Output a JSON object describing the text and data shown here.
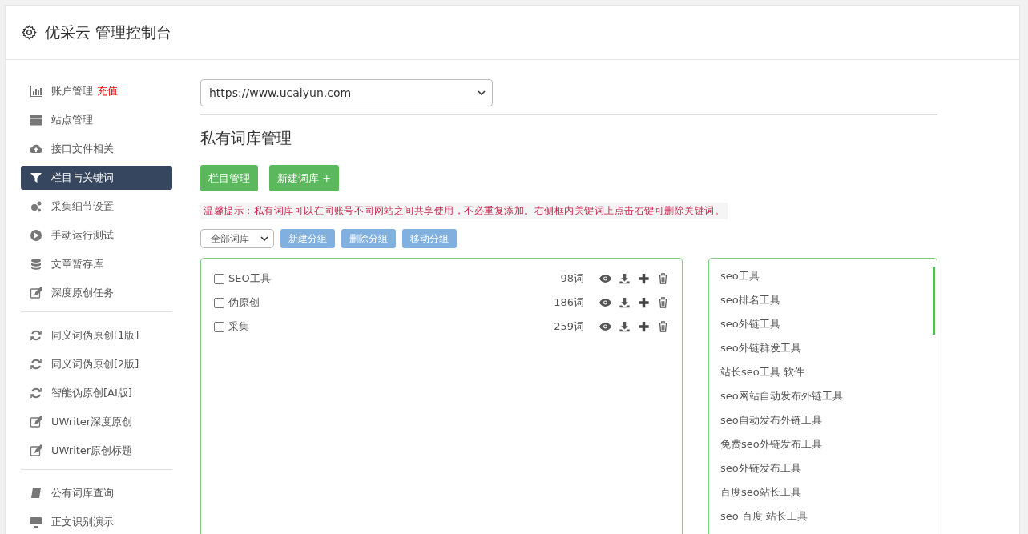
{
  "header": {
    "title": "优采云 管理控制台"
  },
  "sidebar": {
    "groups": [
      [
        {
          "label": "账户管理",
          "badge": "充值",
          "selected": false
        },
        {
          "label": "站点管理",
          "selected": false
        },
        {
          "label": "接口文件相关",
          "selected": false
        },
        {
          "label": "栏目与关键词",
          "selected": true
        },
        {
          "label": "采集细节设置",
          "selected": false
        },
        {
          "label": "手动运行测试",
          "selected": false
        },
        {
          "label": "文章暂存库",
          "selected": false
        },
        {
          "label": "深度原创任务",
          "selected": false
        }
      ],
      [
        {
          "label": "同义词伪原创[1版]",
          "selected": false
        },
        {
          "label": "同义词伪原创[2版]",
          "selected": false
        },
        {
          "label": "智能伪原创[AI版]",
          "selected": false
        },
        {
          "label": "UWriter深度原创",
          "selected": false
        },
        {
          "label": "UWriter原创标题",
          "selected": false
        }
      ],
      [
        {
          "label": "公有词库查询",
          "selected": false
        },
        {
          "label": "正文识别演示",
          "selected": false
        }
      ]
    ]
  },
  "site_select": {
    "value": "https://www.ucaiyun.com"
  },
  "section_title": "私有词库管理",
  "primary_buttons": [
    "栏目管理",
    "新建词库 +"
  ],
  "tip": "温馨提示：私有词库可以在同账号不同网站之间共享使用，不必重复添加。右侧框内关键词上点击右键可删除关键词。",
  "group_select": {
    "value": "全部词库"
  },
  "group_buttons": [
    "新建分组",
    "删除分组",
    "移动分组"
  ],
  "libraries": [
    {
      "name": "SEO工具",
      "count": "98词",
      "checked": false
    },
    {
      "name": "伪原创",
      "count": "186词",
      "checked": false
    },
    {
      "name": "采集",
      "count": "259词",
      "checked": false
    }
  ],
  "keywords": [
    "seo工具",
    "seo排名工具",
    "seo外链工具",
    "seo外链群发工具",
    "站长seo工具 软件",
    "seo网站自动发布外链工具",
    "seo自动发布外链工具",
    "免费seo外链发布工具",
    "seo外链发布工具",
    "百度seo站长工具",
    "seo 百度 站长工具"
  ]
}
